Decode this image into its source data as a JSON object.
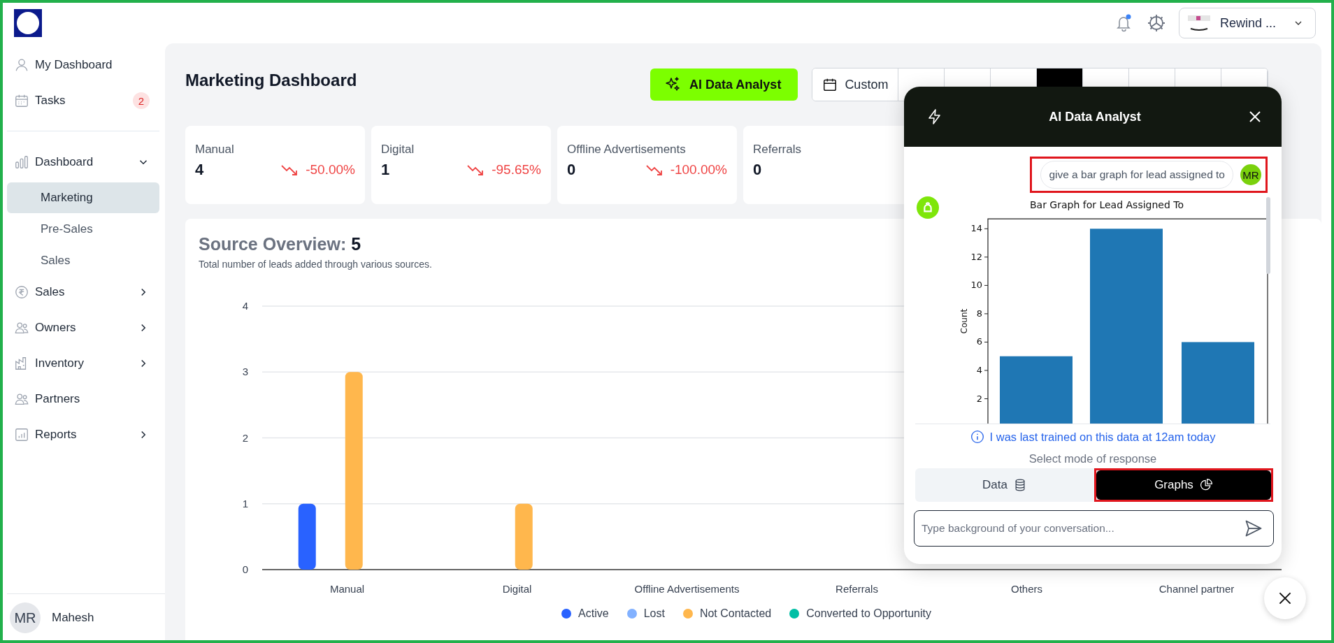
{
  "sidebar": {
    "nav": [
      {
        "label": "My Dashboard",
        "selected": false
      },
      {
        "label": "Tasks",
        "badge": "2",
        "selected": false
      },
      {
        "label": "Dashboard",
        "expanded": true,
        "selected": false,
        "children": [
          {
            "label": "Marketing",
            "selected": true
          },
          {
            "label": "Pre-Sales",
            "selected": false
          },
          {
            "label": "Sales",
            "selected": false
          }
        ]
      },
      {
        "label": "Sales",
        "expanded": false,
        "selected": false
      },
      {
        "label": "Owners",
        "expanded": false,
        "selected": false
      },
      {
        "label": "Inventory",
        "expanded": false,
        "selected": false
      },
      {
        "label": "Partners",
        "selected": false
      },
      {
        "label": "Reports",
        "expanded": false,
        "selected": false
      }
    ],
    "user": {
      "initials": "MR",
      "name": "Mahesh"
    }
  },
  "topbar": {
    "notification_unread": true,
    "account": "Rewind ..."
  },
  "page": {
    "title": "Marketing Dashboard",
    "ai_button": "AI Data Analyst",
    "date_button": "Custom",
    "date_presets": [
      {
        "selected": false
      },
      {
        "selected": false
      },
      {
        "selected": false
      },
      {
        "selected": true
      },
      {
        "selected": false
      },
      {
        "selected": false
      },
      {
        "selected": false
      },
      {
        "selected": false
      }
    ]
  },
  "stats": [
    {
      "label": "Manual",
      "value": "4",
      "change": "-50.00%"
    },
    {
      "label": "Digital",
      "value": "1",
      "change": "-95.65%"
    },
    {
      "label": "Offline Advertisements",
      "value": "0",
      "change": "-100.00%"
    },
    {
      "label": "Referrals",
      "value": "0"
    }
  ],
  "source_overview": {
    "title": "Source Overview:",
    "total": "5",
    "subtitle": "Total number of leads added through various sources.",
    "chart_data": {
      "type": "bar",
      "grid": true,
      "legend": "bottom",
      "categories": [
        "Manual",
        "Digital",
        "Offline Advertisements",
        "Referrals",
        "Others",
        "Channel partner"
      ],
      "yticks": [
        0,
        1,
        2,
        3,
        4
      ],
      "ylim": [
        0,
        4
      ],
      "series": [
        {
          "name": "Active",
          "color": "#2962ff",
          "values": [
            1,
            0,
            0,
            0,
            0,
            0
          ]
        },
        {
          "name": "Lost",
          "color": "#82b1ff",
          "values": [
            0,
            0,
            0,
            0,
            0,
            0
          ]
        },
        {
          "name": "Not Contacted",
          "color": "#ffb74d",
          "values": [
            3,
            1,
            0,
            0,
            0,
            0
          ]
        },
        {
          "name": "Converted to Opportunity",
          "color": "#00bfa5",
          "values": [
            0,
            0,
            0,
            0,
            0,
            0
          ]
        }
      ]
    }
  },
  "ai_panel": {
    "title": "AI Data Analyst",
    "message": {
      "text": "give a bar graph for lead assigned to",
      "initials": "MR",
      "highlighted": true
    },
    "reply_chart": {
      "chart_data": {
        "type": "bar",
        "title": "Bar Graph for Lead Assigned To",
        "ylabel": "Count",
        "categories": [
          null,
          null,
          null
        ],
        "values": [
          5,
          14,
          6
        ],
        "yticks": [
          2,
          4,
          6,
          8,
          10,
          12,
          14
        ],
        "ylim": [
          0.25,
          14.7
        ]
      }
    },
    "info": "I was last trained on this data at 12am today",
    "mode_label": "Select mode of response",
    "modes": [
      {
        "label": "Data",
        "selected": false,
        "highlighted": false
      },
      {
        "label": "Graphs",
        "selected": true,
        "highlighted": true
      }
    ],
    "input": {
      "placeholder": "Type background of your conversation..."
    }
  }
}
